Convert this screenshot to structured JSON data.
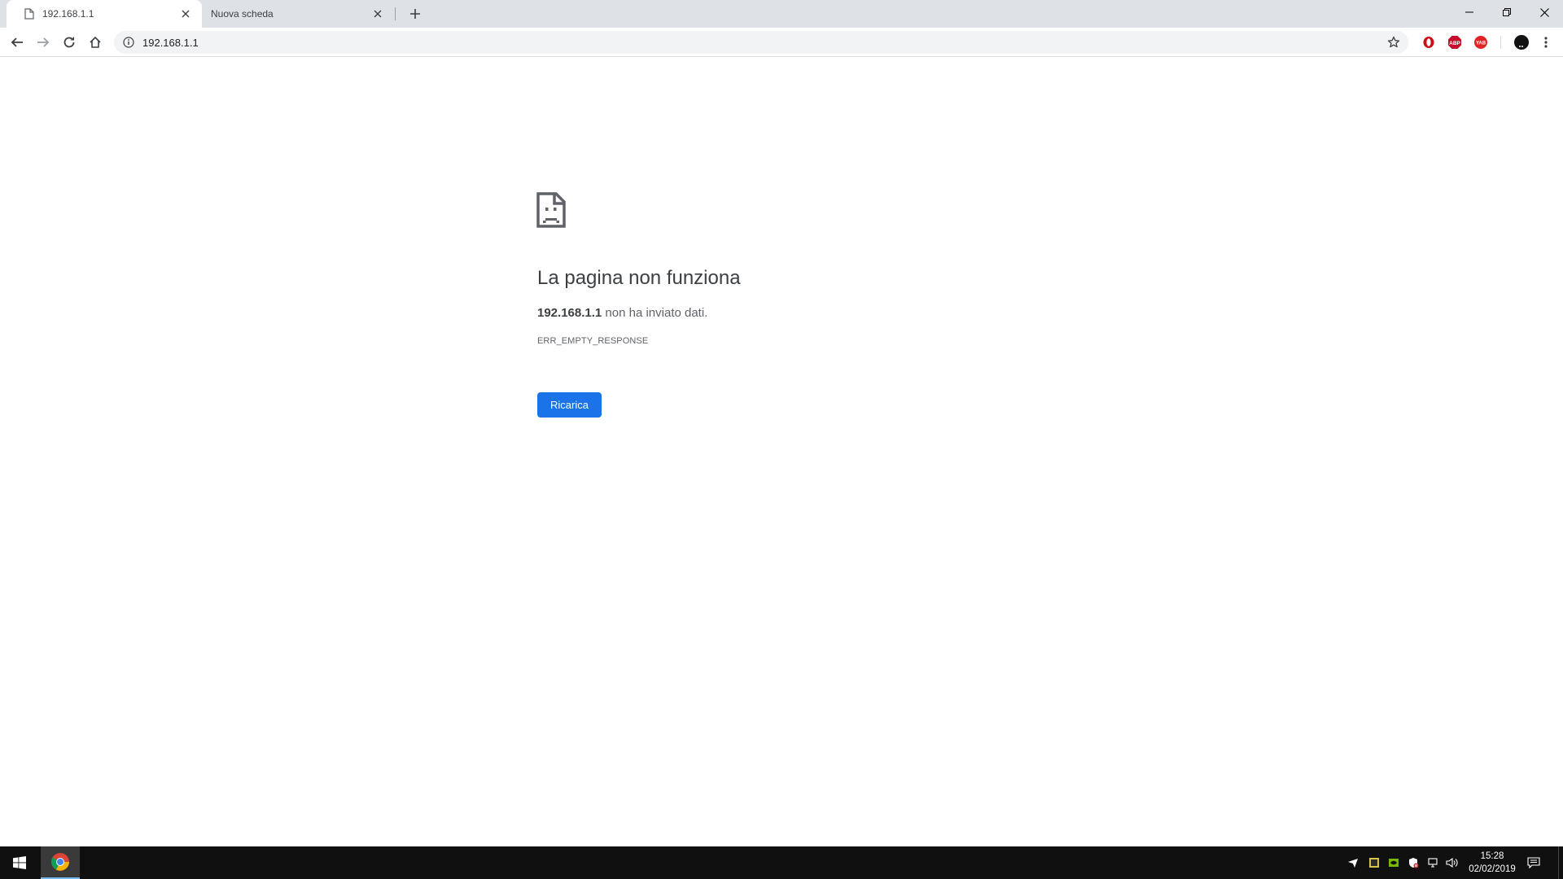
{
  "browser": {
    "tabs": [
      {
        "title": "192.168.1.1",
        "active": true
      },
      {
        "title": "Nuova scheda",
        "active": false
      }
    ],
    "url": "192.168.1.1",
    "colors": {
      "tabstrip": "#dee1e6",
      "toolbar": "#ffffff",
      "omnibox": "#f1f3f4"
    }
  },
  "error_page": {
    "icon": "sad-document-icon",
    "title": "La pagina non funziona",
    "desc_host": "192.168.1.1",
    "desc_rest": " non ha inviato dati.",
    "code": "ERR_EMPTY_RESPONSE",
    "reload_label": "Ricarica",
    "button_color": "#1a73e8"
  },
  "extensions": [
    {
      "name": "opera-icon"
    },
    {
      "name": "abp-icon",
      "label": "ABP"
    },
    {
      "name": "yab-icon",
      "label": "YAB"
    }
  ],
  "taskbar": {
    "time": "15:28",
    "date": "02/02/2019"
  }
}
